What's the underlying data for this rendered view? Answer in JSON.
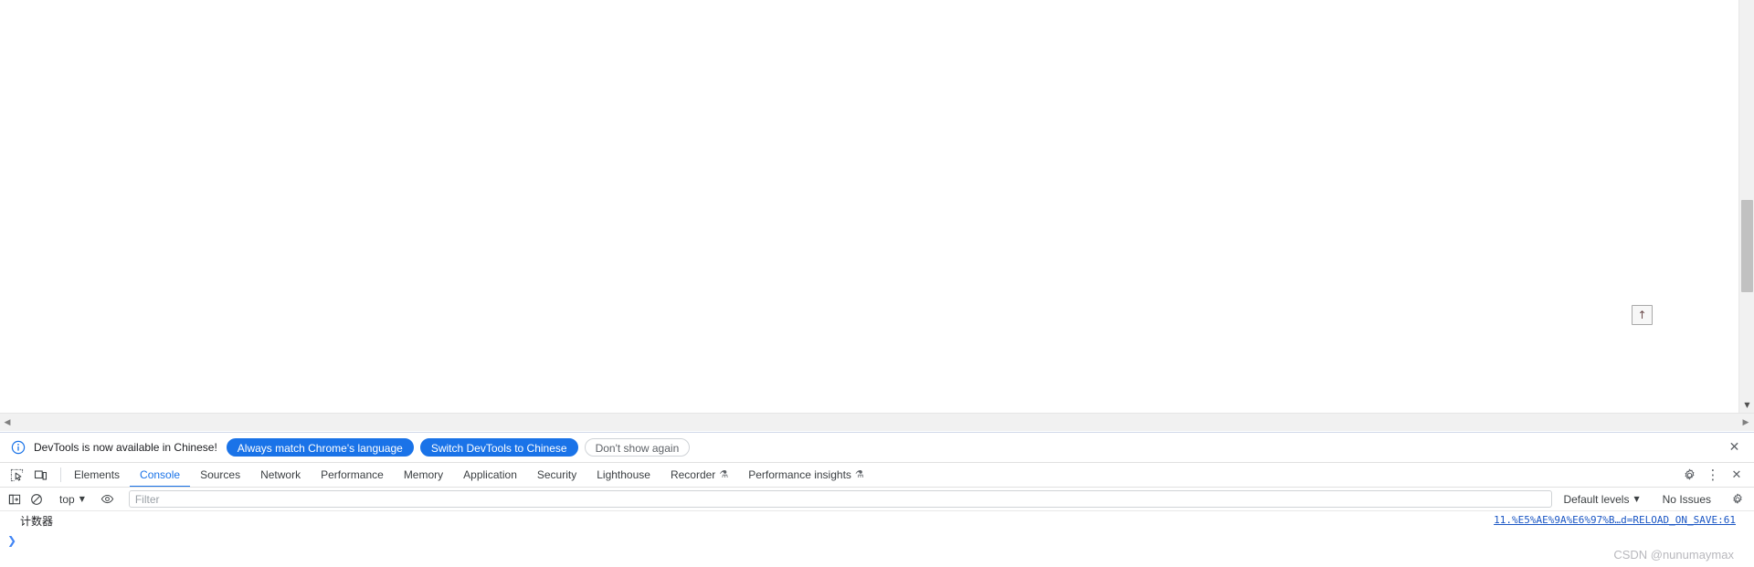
{
  "page": {
    "scroll_top_button": {
      "icon": "arrow-up-icon",
      "glyph": "↑"
    },
    "vertical_scrollbar": {
      "down_arrow": "▼"
    },
    "horizontal_scrollbar": {
      "left_arrow": "◀",
      "right_arrow": "▶"
    }
  },
  "devtools": {
    "infobar": {
      "icon": "info-circle-icon",
      "message": "DevTools is now available in Chinese!",
      "buttons": [
        {
          "label": "Always match Chrome's language",
          "style": "primary"
        },
        {
          "label": "Switch DevTools to Chinese",
          "style": "primary"
        },
        {
          "label": "Don't show again",
          "style": "ghost"
        }
      ],
      "close_glyph": "✕"
    },
    "tabbar": {
      "left_icons": [
        {
          "name": "inspect-element-icon"
        },
        {
          "name": "device-toolbar-icon"
        }
      ],
      "tabs": [
        {
          "label": "Elements",
          "active": false,
          "flask": false
        },
        {
          "label": "Console",
          "active": true,
          "flask": false
        },
        {
          "label": "Sources",
          "active": false,
          "flask": false
        },
        {
          "label": "Network",
          "active": false,
          "flask": false
        },
        {
          "label": "Performance",
          "active": false,
          "flask": false
        },
        {
          "label": "Memory",
          "active": false,
          "flask": false
        },
        {
          "label": "Application",
          "active": false,
          "flask": false
        },
        {
          "label": "Security",
          "active": false,
          "flask": false
        },
        {
          "label": "Lighthouse",
          "active": false,
          "flask": false
        },
        {
          "label": "Recorder",
          "active": false,
          "flask": true
        },
        {
          "label": "Performance insights",
          "active": false,
          "flask": true
        }
      ],
      "flask_glyph": "⚗",
      "right_icons": [
        {
          "name": "settings-gear-icon"
        },
        {
          "name": "more-options-icon",
          "glyph": "⋮"
        },
        {
          "name": "close-devtools-icon",
          "glyph": "✕"
        }
      ]
    },
    "console_toolbar": {
      "sidebar_toggle_icon": "console-sidebar-icon",
      "clear_console_icon": "clear-console-icon",
      "context": {
        "label": "top",
        "caret": "▼"
      },
      "live_expression_icon": "eye-icon",
      "filter": {
        "value": "",
        "placeholder": "Filter"
      },
      "levels": {
        "label": "Default levels",
        "caret": "▼"
      },
      "issues": {
        "label": "No Issues"
      },
      "settings_icon": "console-settings-gear-icon"
    },
    "console_body": {
      "messages": [
        {
          "text": "计数器",
          "source": "11.%E5%AE%9A%E6%97%B…d=RELOAD_ON_SAVE:61"
        }
      ],
      "prompt_glyph": "❯"
    }
  },
  "watermark": {
    "text": "CSDN @nunumaymax"
  },
  "colors": {
    "accent_blue": "#1a73e8",
    "link_blue": "#1a56c4",
    "prompt_blue": "#4285f4",
    "scrollbar_thumb": "#c1c1c1",
    "scrollbar_track": "#f1f1f1",
    "text_primary": "#202124",
    "text_secondary": "#5f6368",
    "watermark_gray": "#b8b8bd"
  }
}
